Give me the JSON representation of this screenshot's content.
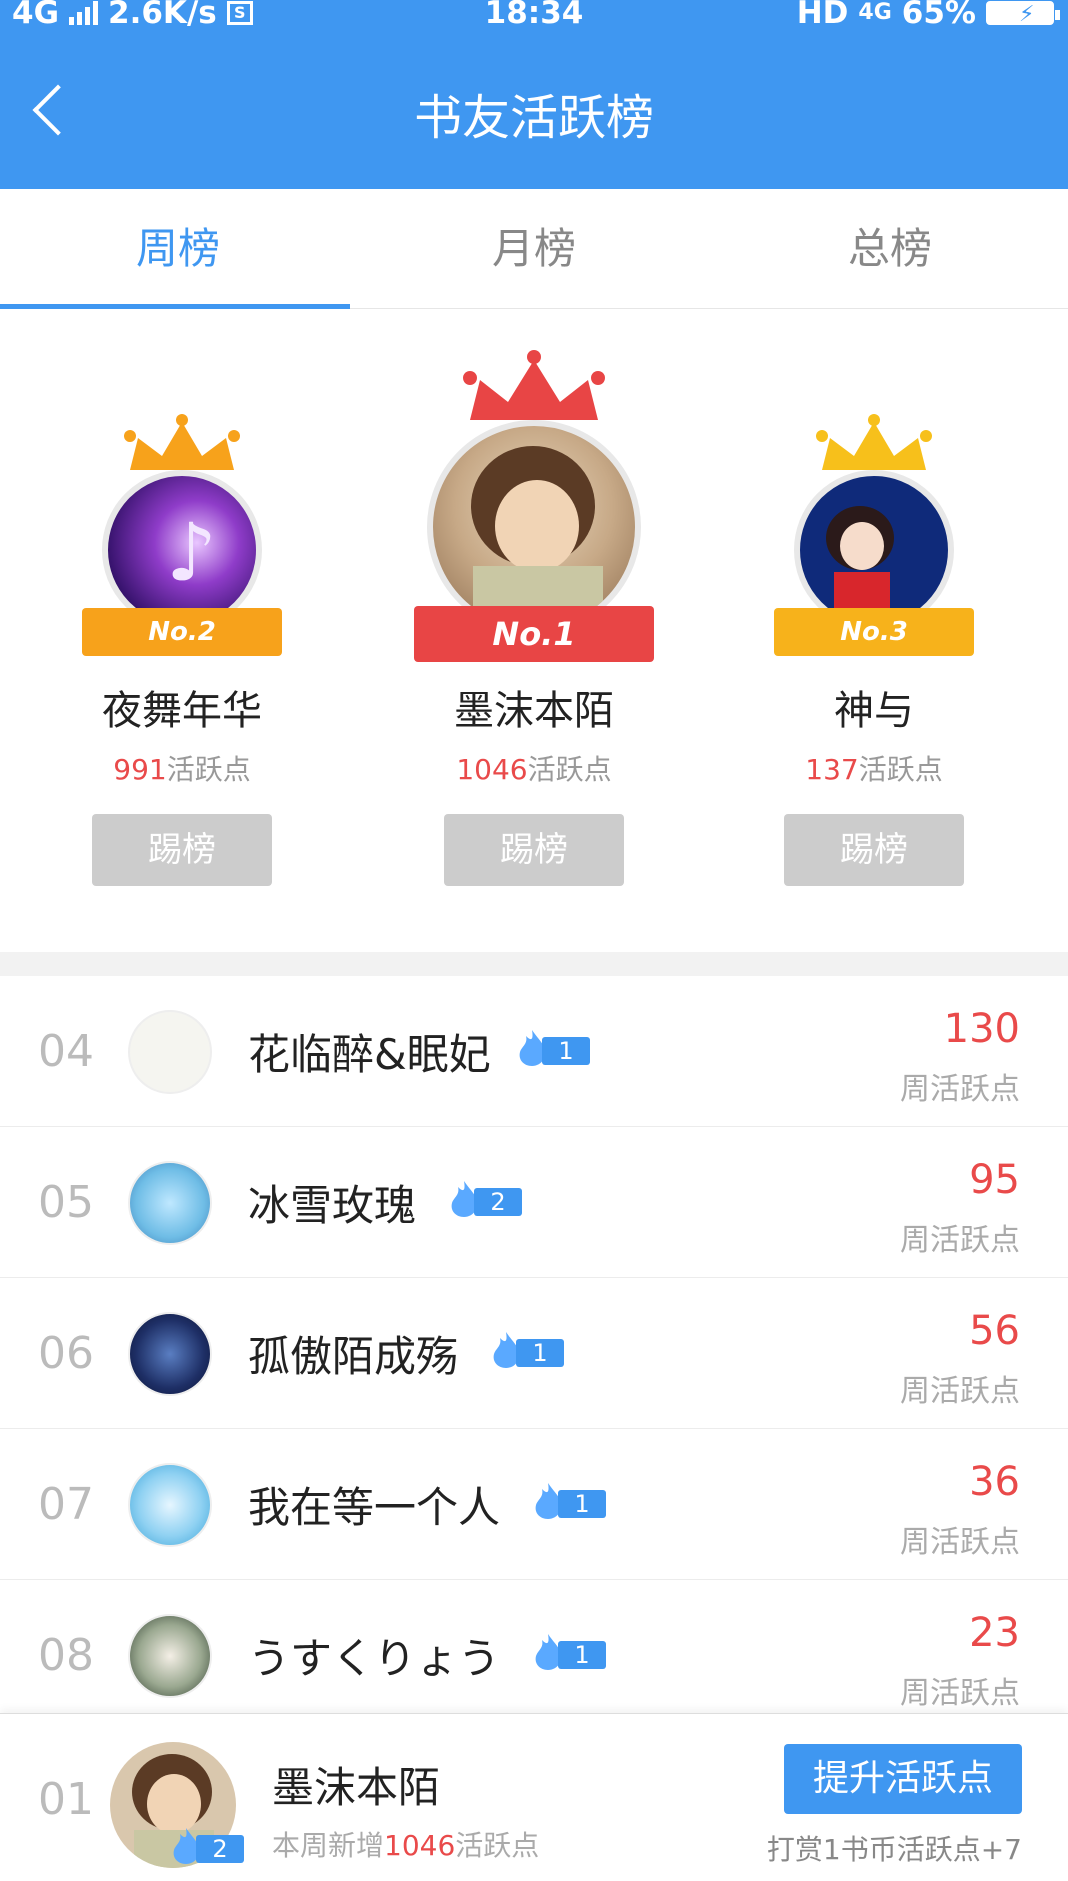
{
  "status": {
    "network": "4G",
    "speed": "2.6K/s",
    "s_label": "S",
    "time": "18:34",
    "hd": "HD",
    "network_right": "4G",
    "battery": "65%"
  },
  "header": {
    "title": "书友活跃榜",
    "back_icon": "chevron-left-icon"
  },
  "tabs": [
    {
      "label": "周榜",
      "active": true
    },
    {
      "label": "月榜",
      "active": false
    },
    {
      "label": "总榜",
      "active": false
    }
  ],
  "podium": {
    "first": {
      "rank_label": "No.1",
      "name": "墨沫本陌",
      "points": "1046",
      "points_unit": "活跃点",
      "kick_label": "踢榜",
      "color": "#e84545"
    },
    "second": {
      "rank_label": "No.2",
      "name": "夜舞年华",
      "points": "991",
      "points_unit": "活跃点",
      "kick_label": "踢榜",
      "color": "#f7a21b"
    },
    "third": {
      "rank_label": "No.3",
      "name": "神与",
      "points": "137",
      "points_unit": "活跃点",
      "kick_label": "踢榜",
      "color": "#f7a21b"
    }
  },
  "list": [
    {
      "rank": "04",
      "name": "花临醉&眠妃",
      "level": "1",
      "score": "130",
      "score_label": "周活跃点"
    },
    {
      "rank": "05",
      "name": "冰雪玫瑰",
      "level": "2",
      "score": "95",
      "score_label": "周活跃点"
    },
    {
      "rank": "06",
      "name": "孤傲陌成殇",
      "level": "1",
      "score": "56",
      "score_label": "周活跃点"
    },
    {
      "rank": "07",
      "name": "我在等一个人",
      "level": "1",
      "score": "36",
      "score_label": "周活跃点"
    },
    {
      "rank": "08",
      "name": "うすくりょう",
      "level": "1",
      "score": "23",
      "score_label": "周活跃点"
    }
  ],
  "me": {
    "rank": "01",
    "name": "墨沫本陌",
    "level": "2",
    "sub_prefix": "本周新增",
    "sub_points": "1046",
    "sub_suffix": "活跃点",
    "boost_label": "提升活跃点",
    "tip": "打赏1书币活跃点+7"
  },
  "colors": {
    "accent": "#3f97f1",
    "red": "#e94a4a",
    "gold": "#f7a21b"
  }
}
